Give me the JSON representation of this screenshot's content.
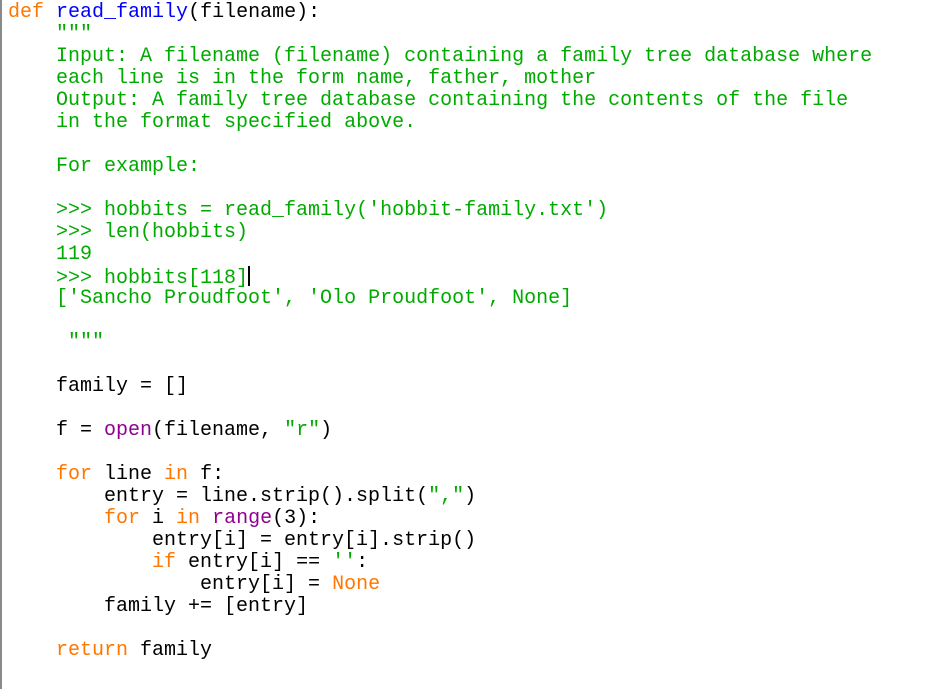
{
  "editor": {
    "colors": {
      "keyword": "#ff7700",
      "function_name": "#0000ff",
      "string": "#00aa00",
      "builtin": "#900090",
      "default": "#000000"
    },
    "lines": [
      [
        {
          "t": "def",
          "c": "kw"
        },
        {
          "t": " "
        },
        {
          "t": "read_family",
          "c": "fn"
        },
        {
          "t": "(filename):"
        }
      ],
      [
        {
          "t": "    "
        },
        {
          "t": "\"\"\"",
          "c": "str"
        }
      ],
      [
        {
          "t": "    "
        },
        {
          "t": "Input: A filename (filename) containing a family tree database where",
          "c": "str"
        }
      ],
      [
        {
          "t": "    "
        },
        {
          "t": "each line is in the form name, father, mother",
          "c": "str"
        }
      ],
      [
        {
          "t": "    "
        },
        {
          "t": "Output: A family tree database containing the contents of the file",
          "c": "str"
        }
      ],
      [
        {
          "t": "    "
        },
        {
          "t": "in the format specified above.",
          "c": "str"
        }
      ],
      [
        {
          "t": ""
        }
      ],
      [
        {
          "t": "    "
        },
        {
          "t": "For example:",
          "c": "str"
        }
      ],
      [
        {
          "t": ""
        }
      ],
      [
        {
          "t": "    "
        },
        {
          "t": ">>> hobbits = read_family('hobbit-family.txt')",
          "c": "str"
        }
      ],
      [
        {
          "t": "    "
        },
        {
          "t": ">>> len(hobbits)",
          "c": "str"
        }
      ],
      [
        {
          "t": "    "
        },
        {
          "t": "119",
          "c": "str"
        }
      ],
      [
        {
          "t": "    "
        },
        {
          "t": ">>> hobbits[118]",
          "c": "str"
        },
        {
          "cursor": true
        }
      ],
      [
        {
          "t": "    "
        },
        {
          "t": "['Sancho Proudfoot', 'Olo Proudfoot', None]",
          "c": "str"
        }
      ],
      [
        {
          "t": ""
        }
      ],
      [
        {
          "t": "     "
        },
        {
          "t": "\"\"\"",
          "c": "str"
        }
      ],
      [
        {
          "t": ""
        }
      ],
      [
        {
          "t": "    family = []"
        }
      ],
      [
        {
          "t": ""
        }
      ],
      [
        {
          "t": "    f = "
        },
        {
          "t": "open",
          "c": "bi"
        },
        {
          "t": "(filename, "
        },
        {
          "t": "\"r\"",
          "c": "str"
        },
        {
          "t": ")"
        }
      ],
      [
        {
          "t": ""
        }
      ],
      [
        {
          "t": "    "
        },
        {
          "t": "for",
          "c": "kw"
        },
        {
          "t": " line "
        },
        {
          "t": "in",
          "c": "kw"
        },
        {
          "t": " f:"
        }
      ],
      [
        {
          "t": "        entry = line.strip().split("
        },
        {
          "t": "\",\"",
          "c": "str"
        },
        {
          "t": ")"
        }
      ],
      [
        {
          "t": "        "
        },
        {
          "t": "for",
          "c": "kw"
        },
        {
          "t": " i "
        },
        {
          "t": "in",
          "c": "kw"
        },
        {
          "t": " "
        },
        {
          "t": "range",
          "c": "bi"
        },
        {
          "t": "(3):"
        }
      ],
      [
        {
          "t": "            entry[i] = entry[i].strip()"
        }
      ],
      [
        {
          "t": "            "
        },
        {
          "t": "if",
          "c": "kw"
        },
        {
          "t": " entry[i] == "
        },
        {
          "t": "''",
          "c": "str"
        },
        {
          "t": ":"
        }
      ],
      [
        {
          "t": "                entry[i] = "
        },
        {
          "t": "None",
          "c": "kw"
        }
      ],
      [
        {
          "t": "        family += [entry]"
        }
      ],
      [
        {
          "t": ""
        }
      ],
      [
        {
          "t": "    "
        },
        {
          "t": "return",
          "c": "kw"
        },
        {
          "t": " family"
        }
      ]
    ]
  }
}
